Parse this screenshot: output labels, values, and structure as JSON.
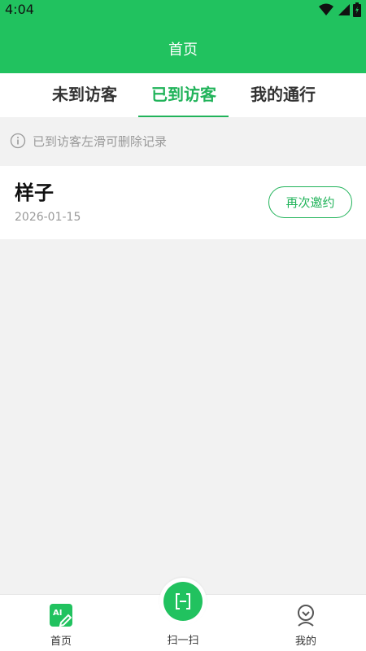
{
  "status": {
    "time": "4:04",
    "icons": [
      "wifi-icon",
      "signal-icon",
      "battery-icon"
    ]
  },
  "header": {
    "title": "首页"
  },
  "tabs": [
    {
      "label": "未到访客",
      "active": false
    },
    {
      "label": "已到访客",
      "active": true
    },
    {
      "label": "我的通行",
      "active": false
    }
  ],
  "tip": {
    "text": "已到访客左滑可删除记录"
  },
  "visitors": [
    {
      "name": "样子",
      "date": "2026-01-15",
      "action_label": "再次邀约"
    }
  ],
  "bottom_nav": {
    "home_label": "首页",
    "scan_label": "扫一扫",
    "mine_label": "我的",
    "home_badge": "AI"
  },
  "colors": {
    "brand_green": "#21c25f",
    "tab_active": "#21b35a",
    "background": "#f2f2f2"
  }
}
